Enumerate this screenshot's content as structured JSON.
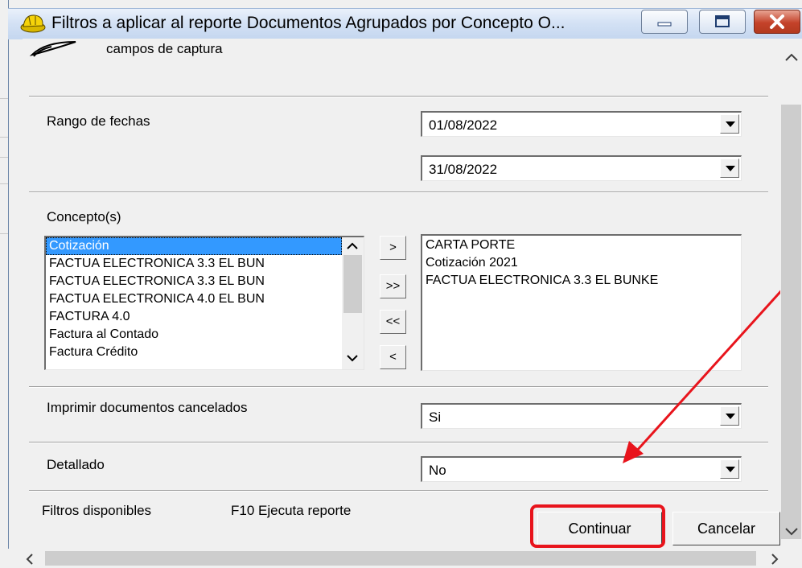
{
  "window": {
    "title": "Filtros a aplicar al reporte Documentos Agrupados por Concepto O...",
    "header_text": "campos de  captura"
  },
  "fecha": {
    "label": "Rango de fechas",
    "desde": "01/08/2022",
    "hasta": "31/08/2022"
  },
  "concepto": {
    "label": "Concepto(s)",
    "disponibles": [
      "Cotización",
      "FACTUA ELECTRONICA 3.3 EL BUN",
      "FACTUA ELECTRONICA 3.3 EL BUN",
      "FACTUA ELECTRONICA 4.0 EL BUN",
      "FACTURA 4.0",
      "Factura al Contado",
      "Factura Crédito"
    ],
    "seleccionados": [
      "CARTA PORTE",
      "Cotización 2021",
      "FACTUA ELECTRONICA 3.3 EL BUNKE"
    ],
    "btn_add": ">",
    "btn_add_all": ">>",
    "btn_remove_all": "<<",
    "btn_remove": "<"
  },
  "cancelados": {
    "label": "Imprimir documentos cancelados",
    "value": "Si"
  },
  "detallado": {
    "label": "Detallado",
    "value": "No"
  },
  "footer": {
    "filtros": "Filtros disponibles",
    "hint": "F10 Ejecuta reporte",
    "continuar": "Continuar",
    "cancelar": "Cancelar"
  },
  "colors": {
    "highlight": "#e8141c",
    "selection": "#3399ff"
  }
}
